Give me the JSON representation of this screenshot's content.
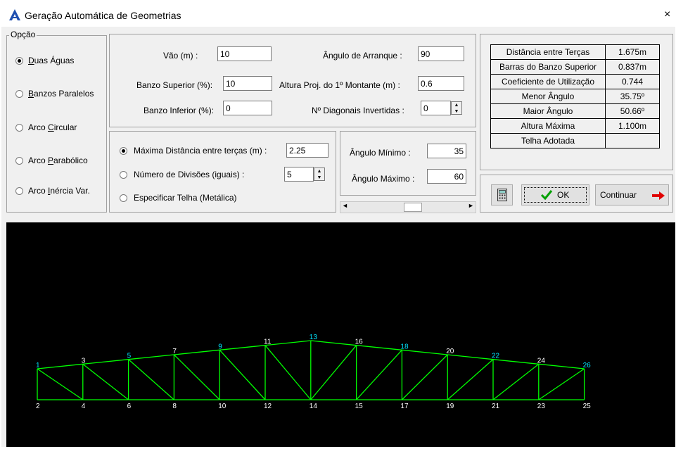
{
  "window": {
    "title": "Geração Automática de Geometrias",
    "close_glyph": "×"
  },
  "opcao": {
    "legend": "Opção",
    "options": [
      {
        "label": "Duas Águas",
        "selected": true
      },
      {
        "label": "Banzos Paralelos",
        "selected": false
      },
      {
        "label": "Arco Circular",
        "selected": false
      },
      {
        "label": "Arco Parabólico",
        "selected": false
      },
      {
        "label": "Arco Inércia Var.",
        "selected": false
      }
    ]
  },
  "params": {
    "vao_label": "Vão (m) :",
    "vao_value": "10",
    "angulo_arranque_label": "Ângulo de Arranque :",
    "angulo_arranque_value": "90",
    "banzo_superior_label": "Banzo Superior (%):",
    "banzo_superior_value": "10",
    "altura_proj_label": "Altura Proj. do 1º Montante (m) :",
    "altura_proj_value": "0.6",
    "banzo_inferior_label": "Banzo Inferior (%):",
    "banzo_inferior_value": "0",
    "diagonais_label": "Nº Diagonais Invertidas :",
    "diagonais_value": "0"
  },
  "divisions": {
    "maxima_label": "Máxima Distância entre terças (m) :",
    "maxima_value": "2.25",
    "maxima_selected": true,
    "numero_label": "Número  de  Divisões  (iguais) :",
    "numero_value": "5",
    "numero_selected": false,
    "especificar_label": "Especificar Telha  (Metálica)",
    "especificar_selected": false
  },
  "angles": {
    "minimo_label": "Ângulo Mínimo :",
    "minimo_value": "35",
    "maximo_label": "Ângulo Máximo :",
    "maximo_value": "60",
    "scrollbar_level": 0.55
  },
  "results": {
    "rows": [
      {
        "key": "Distância entre Terças",
        "value": "1.675m"
      },
      {
        "key": "Barras do Banzo Superior",
        "value": "0.837m"
      },
      {
        "key": "Coeficiente de Utilização",
        "value": "0.744"
      },
      {
        "key": "Menor Ângulo",
        "value": "35.75º"
      },
      {
        "key": "Maior Ângulo",
        "value": "50.66º"
      },
      {
        "key": "Altura Máxima",
        "value": "1.100m"
      },
      {
        "key": "Telha Adotada",
        "value": ""
      }
    ]
  },
  "buttons": {
    "ok_label": "OK",
    "continuar_label": "Continuar"
  },
  "colors": {
    "truss_line": "#00ff00",
    "node_label": "#ffffff",
    "node_label_highlight": "#00e5ff",
    "canvas_bg": "#000000",
    "continuar_arrow": "#e00000",
    "ok_check": "#00a000"
  },
  "truss": {
    "top_nodes": [
      "1",
      "3",
      "5",
      "7",
      "9",
      "11",
      "13",
      "16",
      "18",
      "20",
      "22",
      "24",
      "26"
    ],
    "bottom_nodes": [
      "2",
      "4",
      "6",
      "8",
      "10",
      "12",
      "14",
      "15",
      "17",
      "19",
      "21",
      "23",
      "25"
    ],
    "highlighted_nodes": [
      "1",
      "5",
      "9",
      "13",
      "18",
      "22",
      "26"
    ]
  }
}
